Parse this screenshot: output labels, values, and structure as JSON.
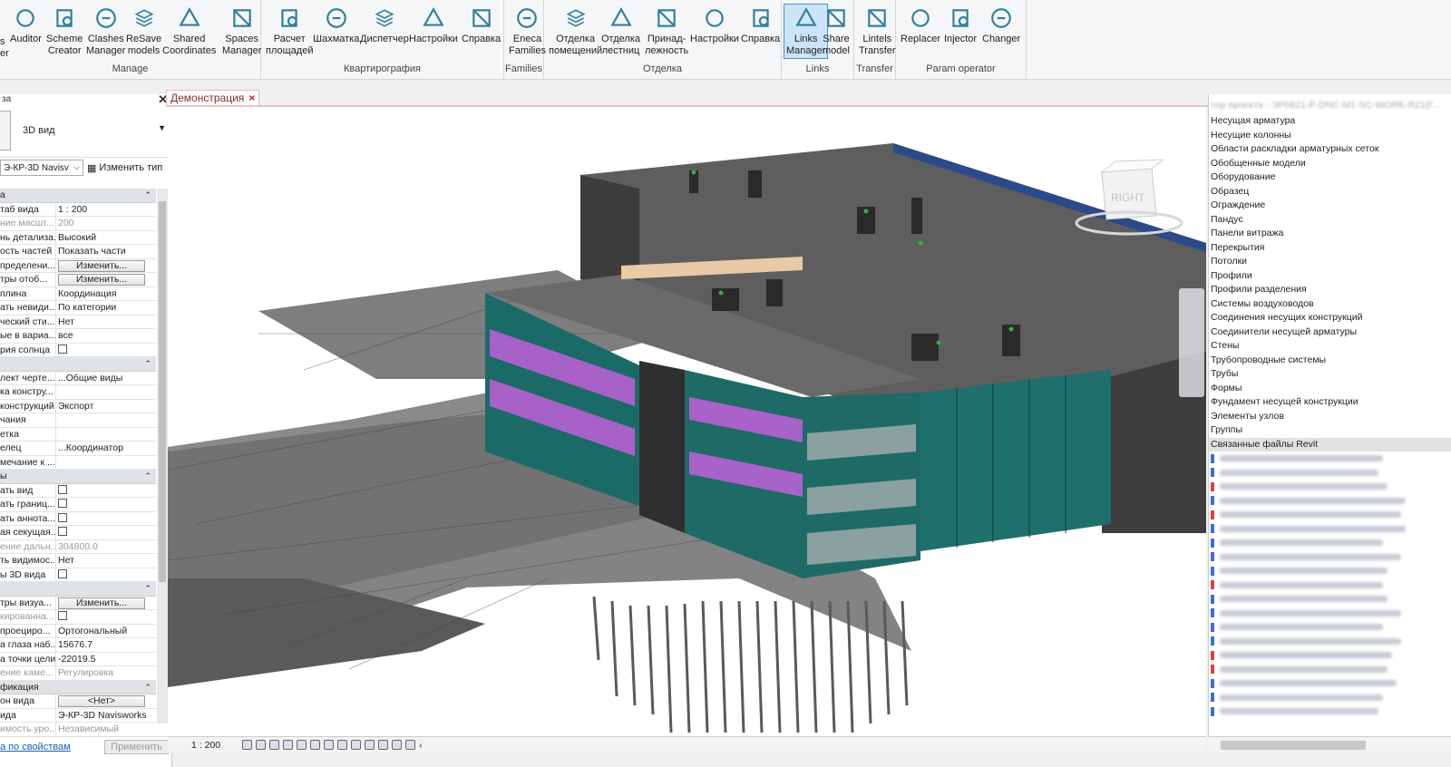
{
  "ribbon": {
    "groups": [
      {
        "title": "Manage",
        "buttons": [
          {
            "label1": "Auditor",
            "label2": ""
          },
          {
            "label1": "Scheme",
            "label2": "Creator"
          },
          {
            "label1": "Clashes",
            "label2": "Manager"
          },
          {
            "label1": "ReSave",
            "label2": "models"
          },
          {
            "label1": "Shared",
            "label2": "Coordinates"
          },
          {
            "label1": "Spaces",
            "label2": "Manager"
          }
        ]
      },
      {
        "title": "Квартирография",
        "buttons": [
          {
            "label1": "Расчет",
            "label2": "площадей"
          },
          {
            "label1": "Шахматка",
            "label2": ""
          },
          {
            "label1": "Диспетчер",
            "label2": ""
          },
          {
            "label1": "Настройки",
            "label2": ""
          },
          {
            "label1": "Справка",
            "label2": ""
          }
        ]
      },
      {
        "title": "Families",
        "buttons": [
          {
            "label1": "Eneca",
            "label2": "Families"
          }
        ]
      },
      {
        "title": "Отделка",
        "buttons": [
          {
            "label1": "Отделка",
            "label2": "помещений"
          },
          {
            "label1": "Отделка",
            "label2": "лестниц"
          },
          {
            "label1": "Принад-",
            "label2": "лежность"
          },
          {
            "label1": "Настройки",
            "label2": ""
          },
          {
            "label1": "Справка",
            "label2": ""
          }
        ]
      },
      {
        "title": "Links",
        "buttons": [
          {
            "label1": "Links",
            "label2": "Manager"
          },
          {
            "label1": "Share",
            "label2": "model"
          }
        ]
      },
      {
        "title": "Transfer",
        "buttons": [
          {
            "label1": "Lintels",
            "label2": "Transfer"
          }
        ]
      },
      {
        "title": "Param operator",
        "buttons": [
          {
            "label1": "Replacer",
            "label2": ""
          },
          {
            "label1": "Injector",
            "label2": ""
          },
          {
            "label1": "Changer",
            "label2": ""
          }
        ]
      }
    ],
    "left_cut": {
      "a": "s",
      "b": "er"
    }
  },
  "props": {
    "head": "за",
    "type_name": "3D вид",
    "instance_select": "Э-КР-3D Navisv",
    "edit_type": "Изменить тип",
    "rows": [
      {
        "kind": "section",
        "label": "а"
      },
      {
        "k": "таб вида",
        "v": "1 : 200"
      },
      {
        "k": "ние масшт...",
        "v": "200",
        "dim": true
      },
      {
        "k": "нь детализа...",
        "v": "Высокий"
      },
      {
        "k": "ость частей",
        "v": "Показать части"
      },
      {
        "k": "пределени...",
        "btn": "Изменить..."
      },
      {
        "k": "тры отоб...",
        "btn": "Изменить..."
      },
      {
        "k": "плина",
        "v": "Координация"
      },
      {
        "k": "ать невиди...",
        "v": "По категории"
      },
      {
        "k": "ческий сти...",
        "v": "Нет"
      },
      {
        "k": "ые в вариа...",
        "v": "все"
      },
      {
        "k": "рия солнца",
        "cb": true
      },
      {
        "kind": "section",
        "label": ""
      },
      {
        "k": "лект черте...",
        "v": "...Общие виды"
      },
      {
        "k": "ка констру...",
        "v": ""
      },
      {
        "k": "конструкций",
        "v": "Экспорт"
      },
      {
        "k": "чания",
        "v": ""
      },
      {
        "k": "етка",
        "v": ""
      },
      {
        "k": "елец",
        "v": "...Координатор"
      },
      {
        "k": "мечание к ...",
        "v": ""
      },
      {
        "kind": "section",
        "label": "ы"
      },
      {
        "k": "ать вид",
        "cb": true
      },
      {
        "k": "ать границ...",
        "cb": true
      },
      {
        "k": "ать аннота...",
        "cb": true
      },
      {
        "k": "ая секущая...",
        "cb": true
      },
      {
        "k": "ение дальн...",
        "v": "304800.0",
        "dim": true
      },
      {
        "k": "ть видимос...",
        "v": "Нет"
      },
      {
        "k": "ы 3D вида",
        "cb": true
      },
      {
        "kind": "section",
        "label": ""
      },
      {
        "k": "тры визуа...",
        "btn": "Изменить..."
      },
      {
        "k": "кированна...",
        "cb": true,
        "dim": true
      },
      {
        "k": "проециро...",
        "v": "Ортогональный"
      },
      {
        "k": "а глаза наб...",
        "v": "15676.7"
      },
      {
        "k": "а точки цели",
        "v": "-22019.5"
      },
      {
        "k": "ение каме...",
        "v": "Регулировка",
        "dim": true
      },
      {
        "kind": "section",
        "label": "фикация"
      },
      {
        "k": "он вида",
        "btn": "<Нет>"
      },
      {
        "k": "ида",
        "v": "Э-КР-3D Navisworks"
      },
      {
        "k": "имость уро...",
        "v": "Независимый",
        "dim": true
      }
    ],
    "footer_link": "а по свойствам",
    "apply": "Применить"
  },
  "view_tab": {
    "title": "Демонстрация",
    "close": "×"
  },
  "viewcube": {
    "right": "RIGHT"
  },
  "status": {
    "scale": "1 : 200"
  },
  "browser": {
    "head": "тор проекта - ЭР0621-Р-DNC-М1-SC-WORK-R21(Г...",
    "items": [
      "Несущая арматура",
      "Несущие колонны",
      "Области раскладки арматурных сеток",
      "Обобщенные модели",
      "Оборудование",
      "Образец",
      "Ограждение",
      "Пандус",
      "Панели витража",
      "Перекрытия",
      "Потолки",
      "Профили",
      "Профили разделения",
      "Системы воздуховодов",
      "Соединения несущих конструкций",
      "Соединители несущей арматуры",
      "Стены",
      "Трубопроводные системы",
      "Трубы",
      "Формы",
      "Фундамент несущей конструкции",
      "Элементы узлов",
      "Группы"
    ],
    "selected": "Связанные файлы Revit",
    "blurred_count": 19
  },
  "colors": {
    "accent": "#4a90d9",
    "facade_teal": "#1f6f6c",
    "facade_purple": "#b040c8",
    "roof": "#5a5a5a"
  }
}
